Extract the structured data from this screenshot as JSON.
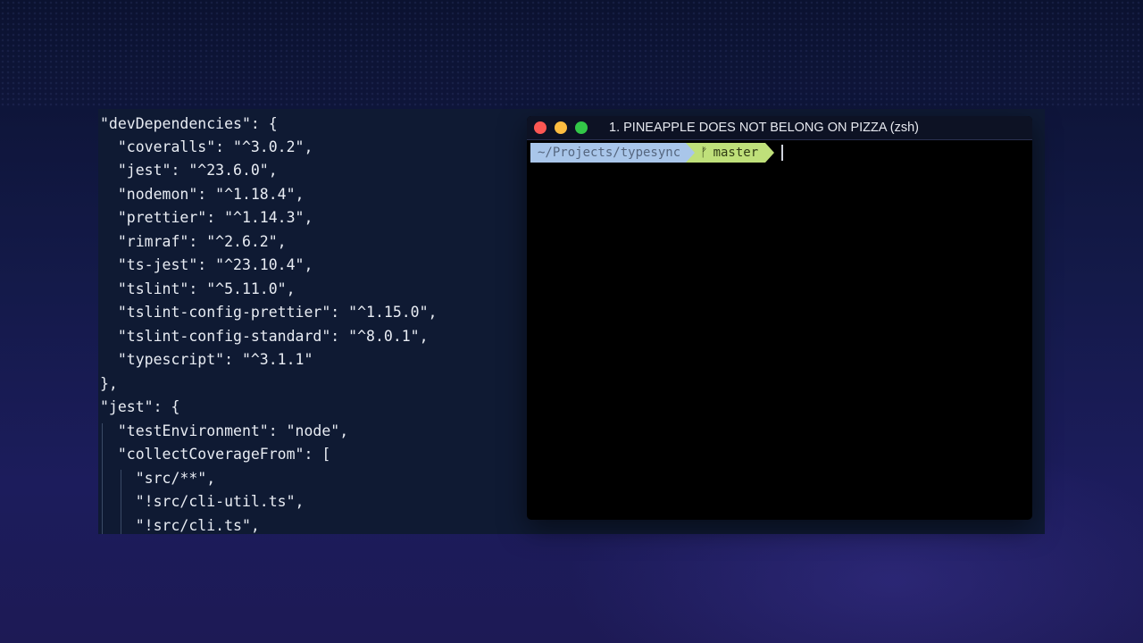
{
  "editor": {
    "lines": [
      "\"devDependencies\": {",
      "  \"coveralls\": \"^3.0.2\",",
      "  \"jest\": \"^23.6.0\",",
      "  \"nodemon\": \"^1.18.4\",",
      "  \"prettier\": \"^1.14.3\",",
      "  \"rimraf\": \"^2.6.2\",",
      "  \"ts-jest\": \"^23.10.4\",",
      "  \"tslint\": \"^5.11.0\",",
      "  \"tslint-config-prettier\": \"^1.15.0\",",
      "  \"tslint-config-standard\": \"^8.0.1\",",
      "  \"typescript\": \"^3.1.1\"",
      "},",
      "\"jest\": {",
      "  \"testEnvironment\": \"node\",",
      "  \"collectCoverageFrom\": [",
      "    \"src/**\",",
      "    \"!src/cli-util.ts\",",
      "    \"!src/cli.ts\","
    ]
  },
  "terminal": {
    "title": "1. PINEAPPLE DOES NOT BELONG ON PIZZA (zsh)",
    "prompt_path": "~/Projects/typesync",
    "branch_icon": "git-branch-icon",
    "branch": "master",
    "colors": {
      "path_bg": "#a9c6ea",
      "git_bg": "#bfe07a",
      "close": "#fc5753",
      "minimize": "#fdbc40",
      "maximize": "#33c748"
    }
  }
}
